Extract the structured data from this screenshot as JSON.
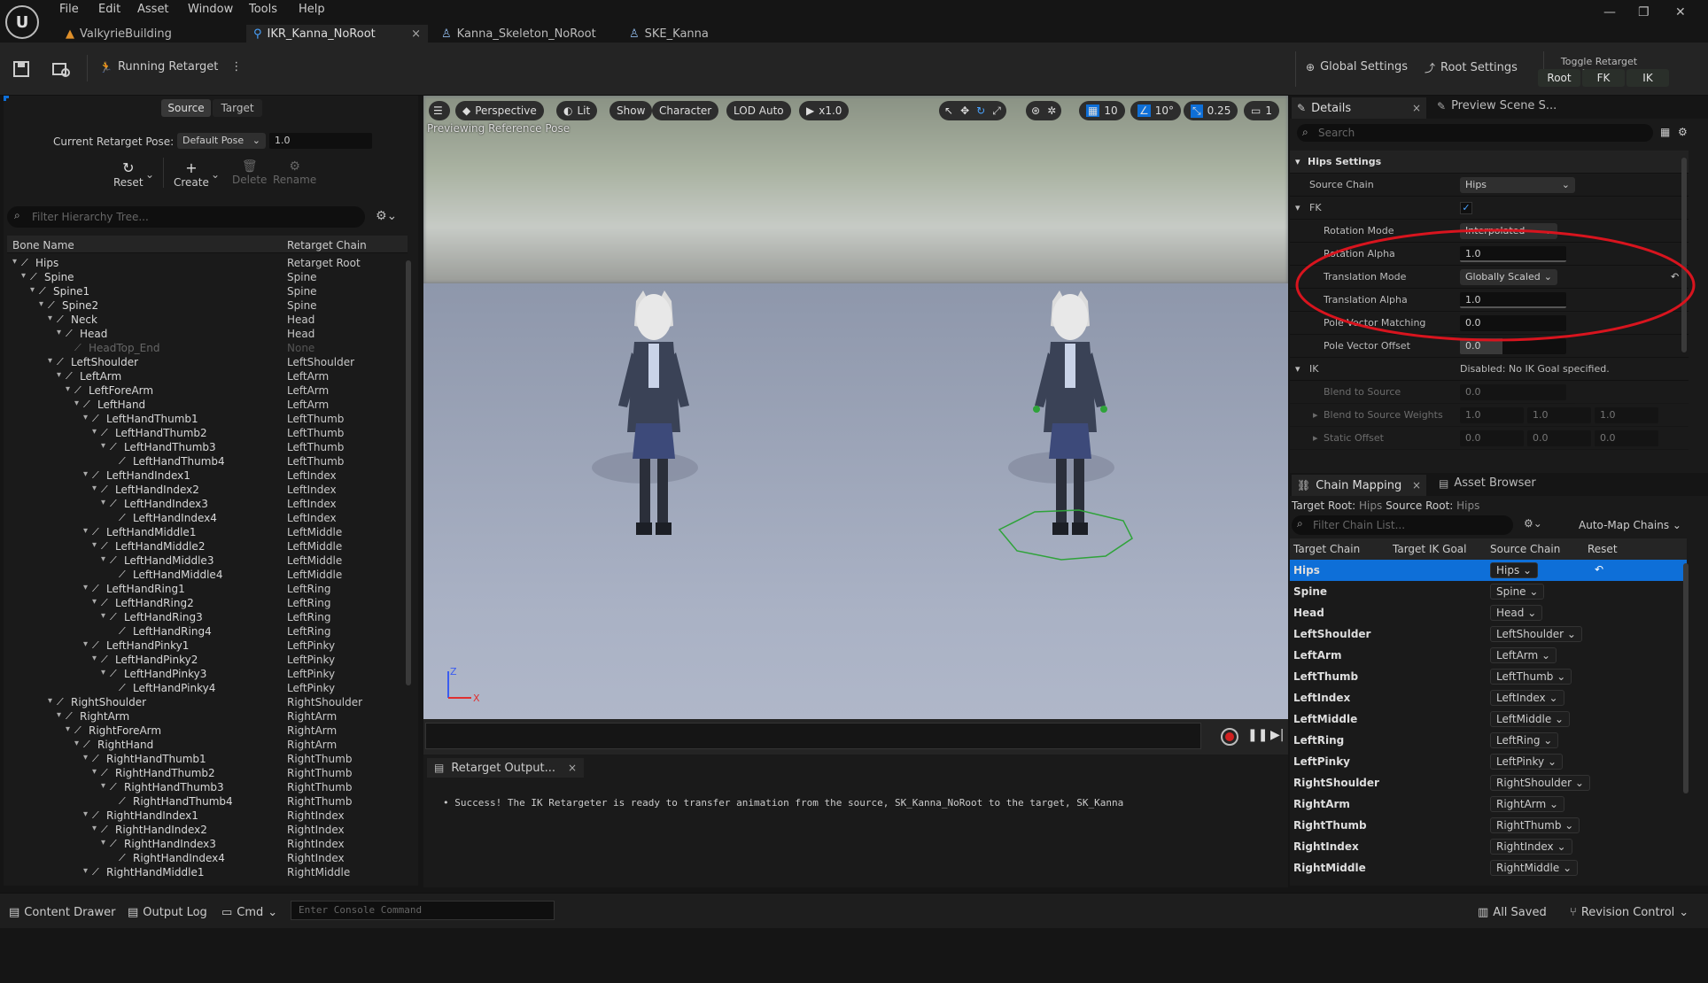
{
  "app": {
    "menu": [
      "File",
      "Edit",
      "Asset",
      "Window",
      "Tools",
      "Help"
    ],
    "tabs": [
      {
        "label": "ValkyrieBuilding",
        "icon": "level-icon"
      },
      {
        "label": "IKR_Kanna_NoRoot",
        "icon": "retargeter-icon",
        "active": true
      },
      {
        "label": "Kanna_Skeleton_NoRoot",
        "icon": "skeleton-icon"
      },
      {
        "label": "SKE_Kanna",
        "icon": "skeleton-icon"
      }
    ],
    "tab_close": "×",
    "window": {
      "minimize": "—",
      "restore": "❐",
      "close": "✕"
    }
  },
  "toolbar": {
    "running_retarget": "Running Retarget",
    "more": "⋮",
    "global_settings": "Global Settings",
    "root_settings": "Root Settings",
    "phases_title": "Toggle Retarget Phases",
    "phases": [
      "Root",
      "FK",
      "IK"
    ]
  },
  "left": {
    "tabs": [
      "Source",
      "Target"
    ],
    "pose_label": "Current Retarget Pose:",
    "pose_value": "Default Pose",
    "pose_blend": "1.0",
    "actions": [
      "Reset",
      "Create",
      "Delete",
      "Rename"
    ],
    "filter_placeholder": "Filter Hierarchy Tree...",
    "col_bone": "Bone Name",
    "col_chain": "Retarget Chain",
    "bones": [
      {
        "name": "Hips",
        "chain": "Retarget Root",
        "d": 0
      },
      {
        "name": "Spine",
        "chain": "Spine",
        "d": 1
      },
      {
        "name": "Spine1",
        "chain": "Spine",
        "d": 2
      },
      {
        "name": "Spine2",
        "chain": "Spine",
        "d": 3
      },
      {
        "name": "Neck",
        "chain": "Head",
        "d": 4
      },
      {
        "name": "Head",
        "chain": "Head",
        "d": 5
      },
      {
        "name": "HeadTop_End",
        "chain": "None",
        "d": 6,
        "dim": true
      },
      {
        "name": "LeftShoulder",
        "chain": "LeftShoulder",
        "d": 4
      },
      {
        "name": "LeftArm",
        "chain": "LeftArm",
        "d": 5
      },
      {
        "name": "LeftForeArm",
        "chain": "LeftArm",
        "d": 6
      },
      {
        "name": "LeftHand",
        "chain": "LeftArm",
        "d": 7
      },
      {
        "name": "LeftHandThumb1",
        "chain": "LeftThumb",
        "d": 8
      },
      {
        "name": "LeftHandThumb2",
        "chain": "LeftThumb",
        "d": 9
      },
      {
        "name": "LeftHandThumb3",
        "chain": "LeftThumb",
        "d": 10
      },
      {
        "name": "LeftHandThumb4",
        "chain": "LeftThumb",
        "d": 11
      },
      {
        "name": "LeftHandIndex1",
        "chain": "LeftIndex",
        "d": 8
      },
      {
        "name": "LeftHandIndex2",
        "chain": "LeftIndex",
        "d": 9
      },
      {
        "name": "LeftHandIndex3",
        "chain": "LeftIndex",
        "d": 10
      },
      {
        "name": "LeftHandIndex4",
        "chain": "LeftIndex",
        "d": 11
      },
      {
        "name": "LeftHandMiddle1",
        "chain": "LeftMiddle",
        "d": 8
      },
      {
        "name": "LeftHandMiddle2",
        "chain": "LeftMiddle",
        "d": 9
      },
      {
        "name": "LeftHandMiddle3",
        "chain": "LeftMiddle",
        "d": 10
      },
      {
        "name": "LeftHandMiddle4",
        "chain": "LeftMiddle",
        "d": 11
      },
      {
        "name": "LeftHandRing1",
        "chain": "LeftRing",
        "d": 8
      },
      {
        "name": "LeftHandRing2",
        "chain": "LeftRing",
        "d": 9
      },
      {
        "name": "LeftHandRing3",
        "chain": "LeftRing",
        "d": 10
      },
      {
        "name": "LeftHandRing4",
        "chain": "LeftRing",
        "d": 11
      },
      {
        "name": "LeftHandPinky1",
        "chain": "LeftPinky",
        "d": 8
      },
      {
        "name": "LeftHandPinky2",
        "chain": "LeftPinky",
        "d": 9
      },
      {
        "name": "LeftHandPinky3",
        "chain": "LeftPinky",
        "d": 10
      },
      {
        "name": "LeftHandPinky4",
        "chain": "LeftPinky",
        "d": 11
      },
      {
        "name": "RightShoulder",
        "chain": "RightShoulder",
        "d": 4
      },
      {
        "name": "RightArm",
        "chain": "RightArm",
        "d": 5
      },
      {
        "name": "RightForeArm",
        "chain": "RightArm",
        "d": 6
      },
      {
        "name": "RightHand",
        "chain": "RightArm",
        "d": 7
      },
      {
        "name": "RightHandThumb1",
        "chain": "RightThumb",
        "d": 8
      },
      {
        "name": "RightHandThumb2",
        "chain": "RightThumb",
        "d": 9
      },
      {
        "name": "RightHandThumb3",
        "chain": "RightThumb",
        "d": 10
      },
      {
        "name": "RightHandThumb4",
        "chain": "RightThumb",
        "d": 11
      },
      {
        "name": "RightHandIndex1",
        "chain": "RightIndex",
        "d": 8
      },
      {
        "name": "RightHandIndex2",
        "chain": "RightIndex",
        "d": 9
      },
      {
        "name": "RightHandIndex3",
        "chain": "RightIndex",
        "d": 10
      },
      {
        "name": "RightHandIndex4",
        "chain": "RightIndex",
        "d": 11
      },
      {
        "name": "RightHandMiddle1",
        "chain": "RightMiddle",
        "d": 8
      }
    ]
  },
  "viewport": {
    "buttons": [
      "Perspective",
      "Lit",
      "Show",
      "Character",
      "LOD Auto",
      "x1.0"
    ],
    "grid": "10",
    "angle": "10°",
    "scale": "0.25",
    "camera": "1",
    "overlay": "Previewing Reference Pose",
    "axis_z": "Z",
    "axis_x": "X"
  },
  "output": {
    "tab": "Retarget Output...",
    "message": "Success! The IK Retargeter is ready to transfer animation from the source, SK_Kanna_NoRoot to the target, SK_Kanna"
  },
  "details": {
    "tab": "Details",
    "tab2": "Preview Scene S...",
    "search_placeholder": "Search",
    "section_hips": "Hips Settings",
    "source_chain_label": "Source Chain",
    "source_chain_value": "Hips",
    "fk_label": "FK",
    "rotation_mode_label": "Rotation Mode",
    "rotation_mode_value": "Interpolated",
    "rotation_alpha_label": "Rotation Alpha",
    "rotation_alpha_value": "1.0",
    "translation_mode_label": "Translation Mode",
    "translation_mode_value": "Globally Scaled",
    "translation_alpha_label": "Translation Alpha",
    "translation_alpha_value": "1.0",
    "pole_match_label": "Pole Vector Matching",
    "pole_match_value": "0.0",
    "pole_offset_label": "Pole Vector Offset",
    "pole_offset_value": "0.0",
    "ik_label": "IK",
    "ik_status": "Disabled: No IK Goal specified.",
    "blend_label": "Blend to Source",
    "blend_value": "0.0",
    "blend_weights_label": "Blend to Source Weights",
    "blend_weights": [
      "1.0",
      "1.0",
      "1.0"
    ],
    "static_offset_label": "Static Offset",
    "static_offset": [
      "0.0",
      "0.0",
      "0.0"
    ]
  },
  "chain_mapping": {
    "tab": "Chain Mapping",
    "tab2": "Asset Browser",
    "target_root_label": "Target Root:",
    "target_root": "Hips",
    "source_root_label": "Source Root:",
    "source_root": "Hips",
    "filter_placeholder": "Filter Chain List...",
    "automap": "Auto-Map Chains",
    "cols": [
      "Target Chain",
      "Target IK Goal",
      "Source Chain",
      "Reset"
    ],
    "rows": [
      {
        "target": "Hips",
        "source": "Hips"
      },
      {
        "target": "Spine",
        "source": "Spine"
      },
      {
        "target": "Head",
        "source": "Head"
      },
      {
        "target": "LeftShoulder",
        "source": "LeftShoulder"
      },
      {
        "target": "LeftArm",
        "source": "LeftArm"
      },
      {
        "target": "LeftThumb",
        "source": "LeftThumb"
      },
      {
        "target": "LeftIndex",
        "source": "LeftIndex"
      },
      {
        "target": "LeftMiddle",
        "source": "LeftMiddle"
      },
      {
        "target": "LeftRing",
        "source": "LeftRing"
      },
      {
        "target": "LeftPinky",
        "source": "LeftPinky"
      },
      {
        "target": "RightShoulder",
        "source": "RightShoulder"
      },
      {
        "target": "RightArm",
        "source": "RightArm"
      },
      {
        "target": "RightThumb",
        "source": "RightThumb"
      },
      {
        "target": "RightIndex",
        "source": "RightIndex"
      },
      {
        "target": "RightMiddle",
        "source": "RightMiddle"
      }
    ]
  },
  "bottom": {
    "content_drawer": "Content Drawer",
    "output_log": "Output Log",
    "cmd": "Cmd",
    "console_placeholder": "Enter Console Command",
    "all_saved": "All Saved",
    "revision": "Revision Control"
  },
  "colors": {
    "accent": "#0e6fd8",
    "annotation": "#d8141e",
    "selected": "#0e6fd8"
  }
}
